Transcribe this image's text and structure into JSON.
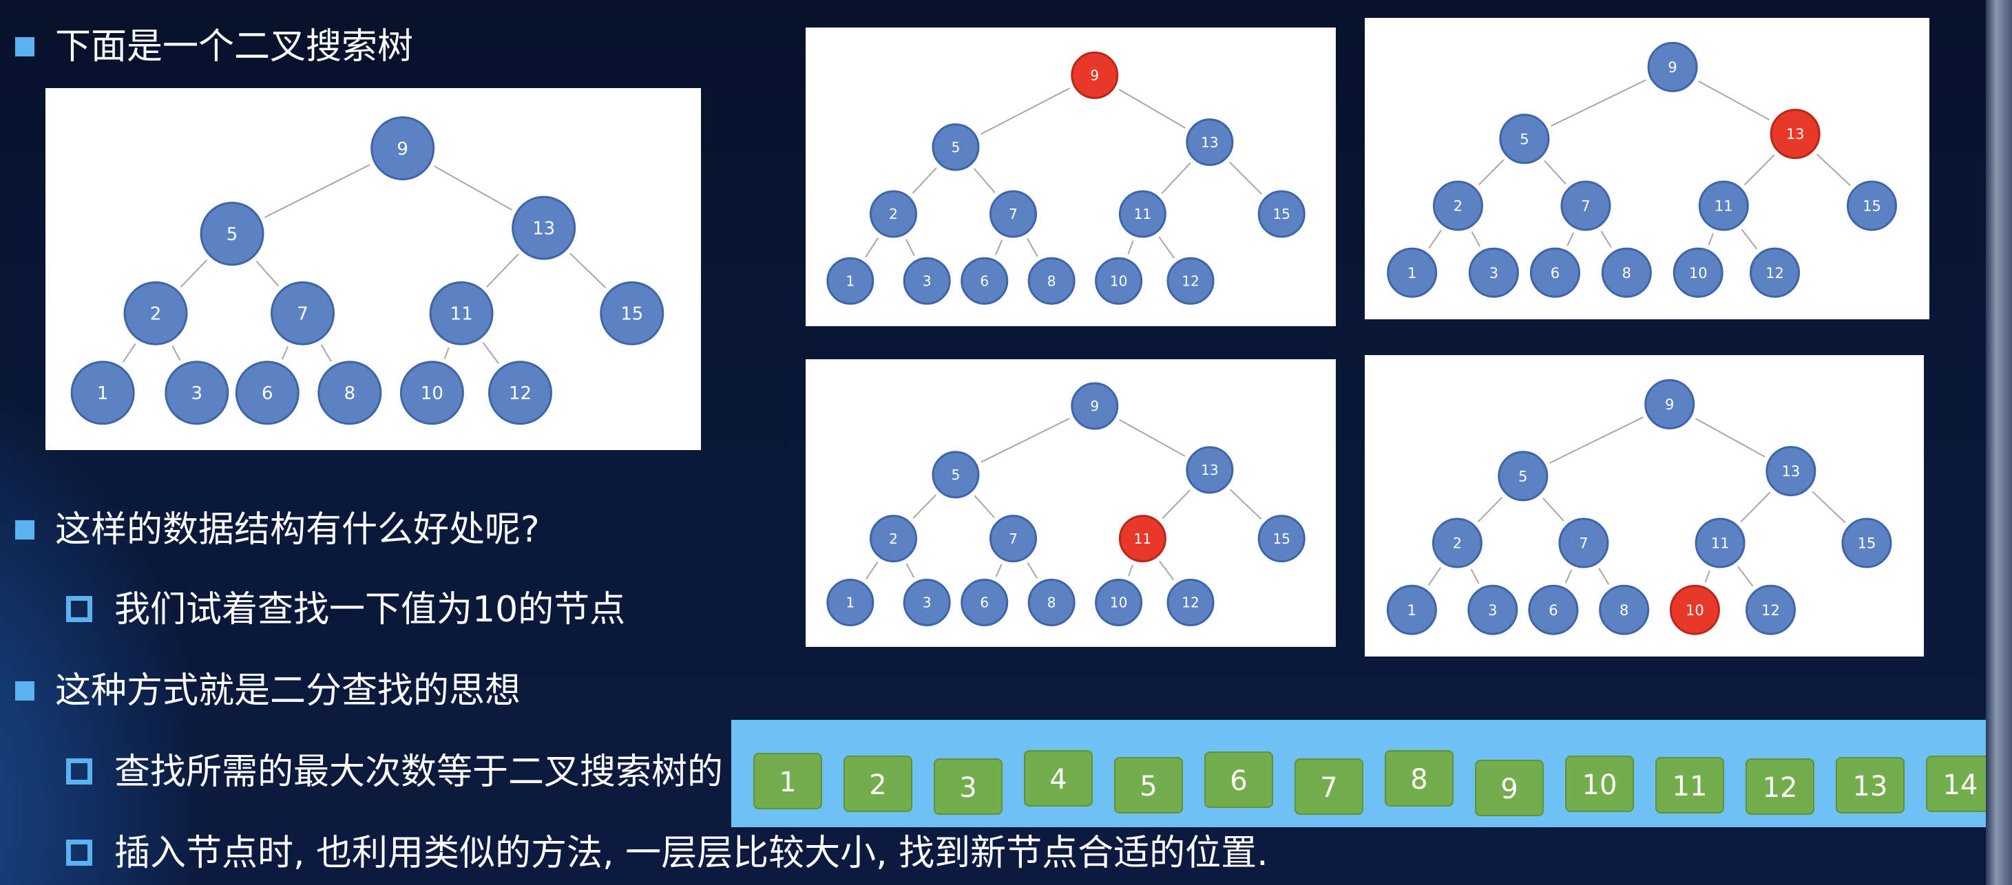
{
  "bullets": {
    "b1": "下面是一个二叉搜索树",
    "b2": "这样的数据结构有什么好处呢?",
    "b2a": "我们试着查找一下值为10的节点",
    "b3": "这种方式就是二分查找的思想",
    "b3a": "查找所需的最大次数等于二叉搜索树的",
    "b3b": "插入节点时, 也利用类似的方法, 一层层比较大小, 找到新节点合适的位置."
  },
  "tree": {
    "nodes": [
      9,
      5,
      13,
      2,
      7,
      11,
      15,
      1,
      3,
      6,
      8,
      10,
      12
    ],
    "edges": [
      [
        9,
        5
      ],
      [
        9,
        13
      ],
      [
        5,
        2
      ],
      [
        5,
        7
      ],
      [
        13,
        11
      ],
      [
        13,
        15
      ],
      [
        2,
        1
      ],
      [
        2,
        3
      ],
      [
        7,
        6
      ],
      [
        7,
        8
      ],
      [
        11,
        10
      ],
      [
        11,
        12
      ]
    ]
  },
  "search_steps": [
    {
      "highlight": 9
    },
    {
      "highlight": 13
    },
    {
      "highlight": 11
    },
    {
      "highlight": 10
    }
  ],
  "array_values": [
    "1",
    "2",
    "3",
    "4",
    "5",
    "6",
    "7",
    "8",
    "9",
    "10",
    "11",
    "12",
    "13",
    "14"
  ],
  "colors": {
    "node": "#5b82c2",
    "node_stroke": "#3f65a6",
    "highlight": "#e8382a",
    "accent": "#5ab3f0",
    "cell": "#73ad4c",
    "bar": "#6ec0f5"
  }
}
